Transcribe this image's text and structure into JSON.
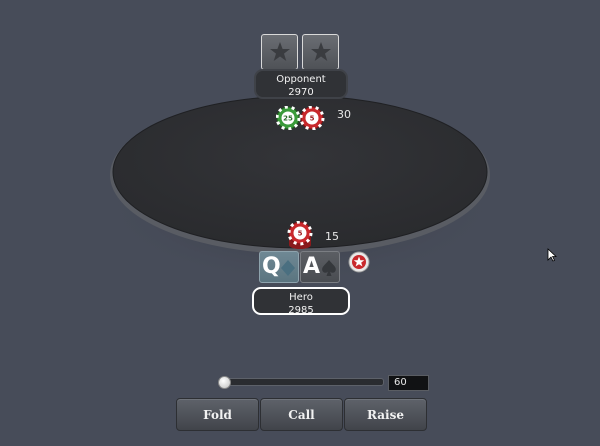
{
  "opponent": {
    "name": "Opponent",
    "stack": "2970",
    "bet": "30",
    "chips": [
      {
        "label": "25",
        "color": "#3a9a3a"
      },
      {
        "label": "5",
        "color": "#c8282c"
      }
    ]
  },
  "hero": {
    "name": "Hero",
    "stack": "2985",
    "bet": "15",
    "cards": [
      {
        "rank": "Q",
        "suit": "diamond"
      },
      {
        "rank": "A",
        "suit": "spade"
      }
    ],
    "chips": [
      {
        "label": "5",
        "color": "#c8282c"
      }
    ]
  },
  "dealer_button": {
    "icon": "pokerstars-star-icon"
  },
  "controls": {
    "raise_amount": "60",
    "slider_position": 0,
    "buttons": {
      "fold": "Fold",
      "call": "Call",
      "raise": "Raise"
    }
  },
  "colors": {
    "background": "#474c59",
    "felt": "#2f3034",
    "chip_green": "#3a9a3a",
    "chip_red": "#c8282c"
  }
}
